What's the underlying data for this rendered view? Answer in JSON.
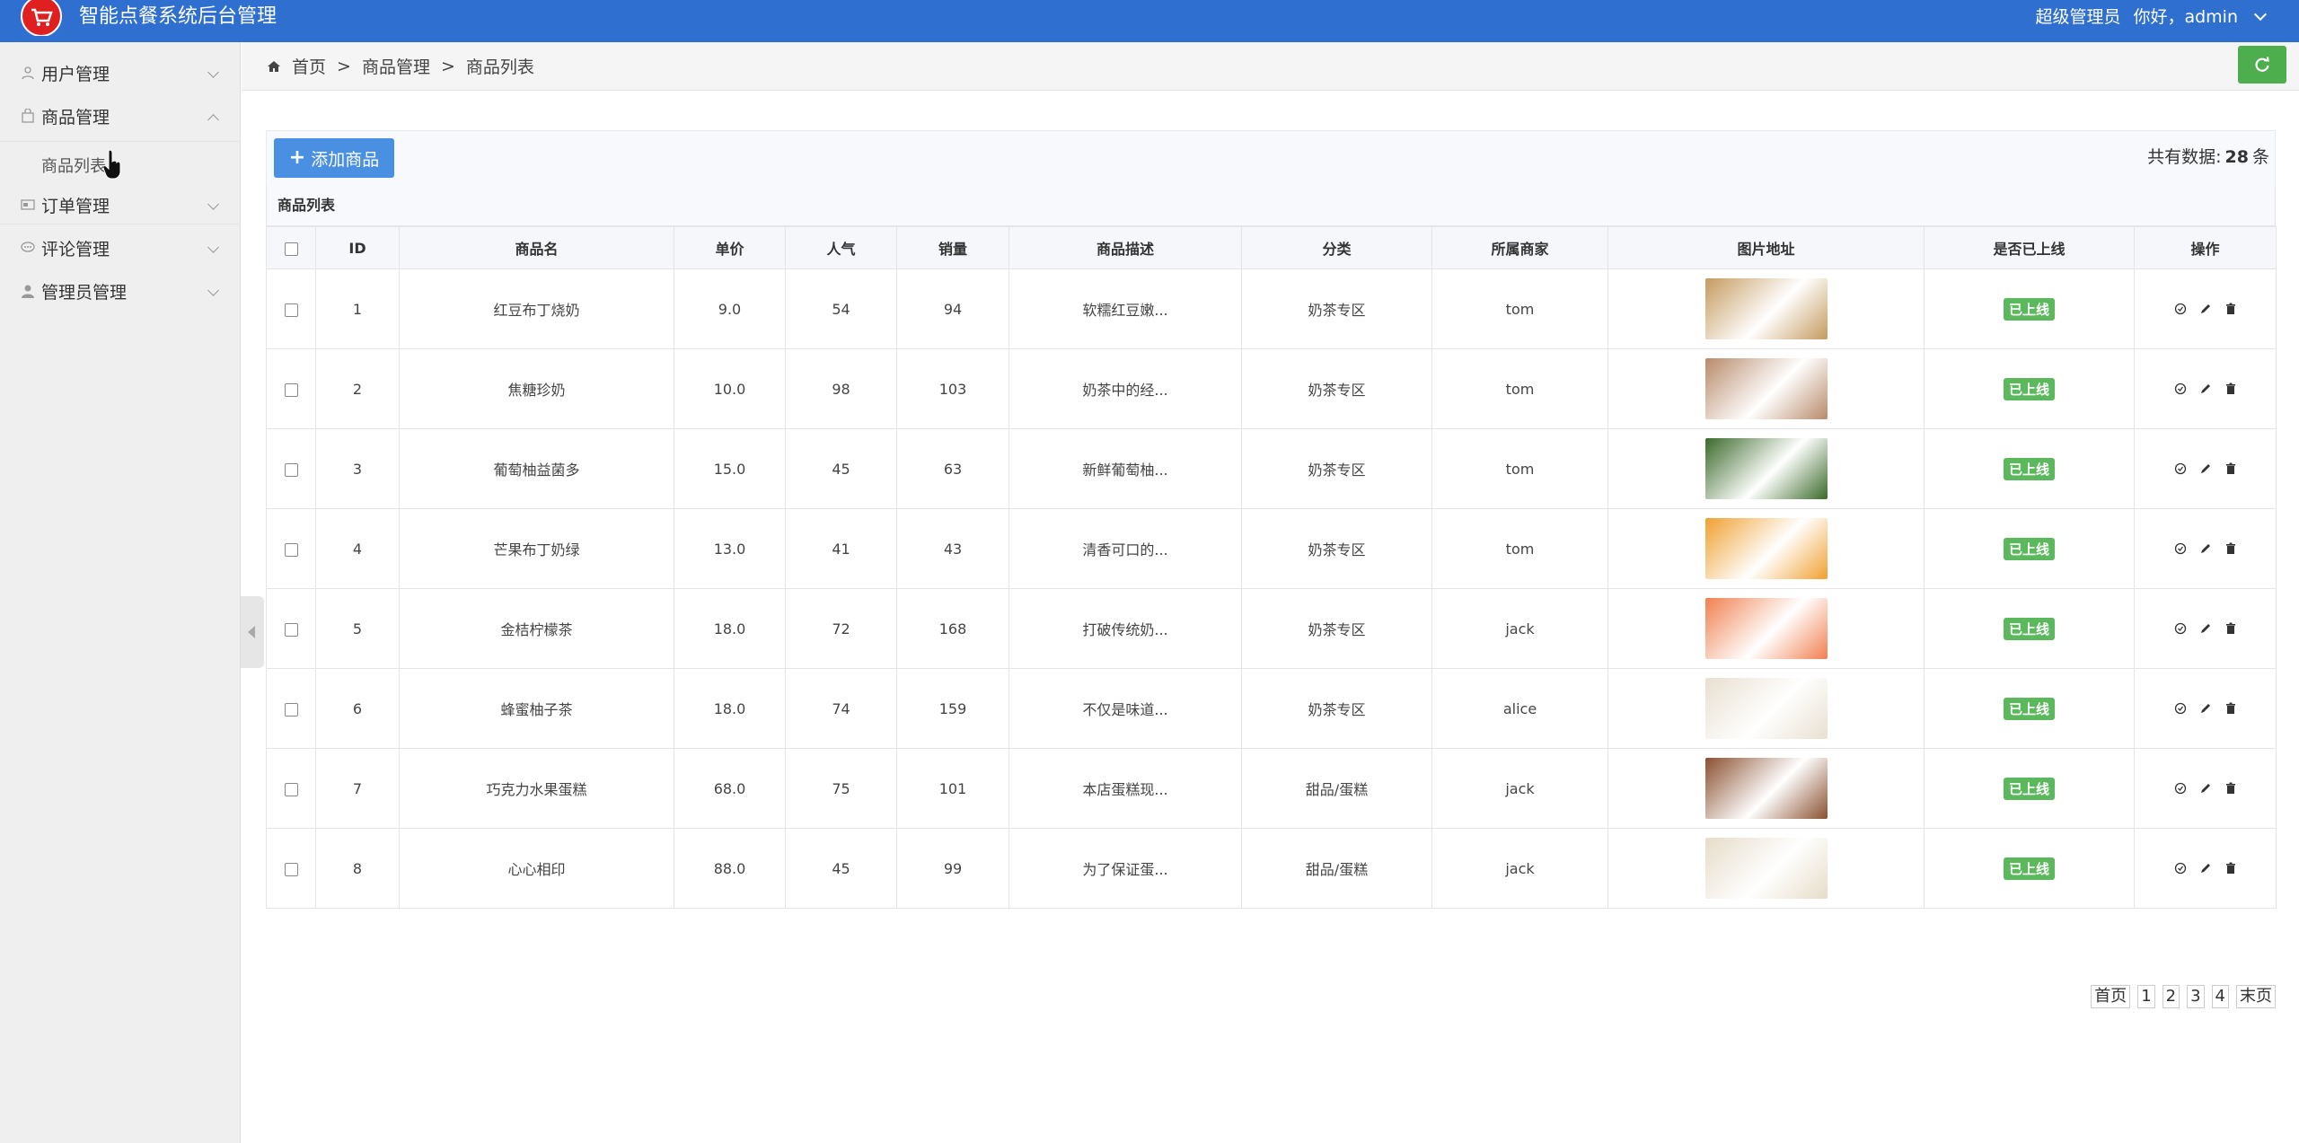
{
  "header": {
    "app_title": "智能点餐系统后台管理",
    "role": "超级管理员",
    "greeting": "你好，admin",
    "accent": "#2f6fd0"
  },
  "sidebar": {
    "items": [
      {
        "label": "用户管理",
        "icon": "user-icon"
      },
      {
        "label": "商品管理",
        "icon": "bag-icon"
      },
      {
        "label": "订单管理",
        "icon": "card-icon"
      },
      {
        "label": "评论管理",
        "icon": "chat-icon"
      },
      {
        "label": "管理员管理",
        "icon": "admin-icon"
      }
    ],
    "sub_item": "商品列表"
  },
  "breadcrumb": {
    "home": "首页",
    "sep": ">",
    "level1": "商品管理",
    "level2": "商品列表"
  },
  "toolbar": {
    "add_label": "添加商品",
    "total_prefix": "共有数据:",
    "total_count": "28",
    "total_suffix": "条"
  },
  "table": {
    "title": "商品列表",
    "headers": [
      "",
      "ID",
      "商品名",
      "单价",
      "人气",
      "销量",
      "商品描述",
      "分类",
      "所属商家",
      "图片地址",
      "是否已上线",
      "操作"
    ],
    "rows": [
      {
        "id": "1",
        "name": "红豆布丁烧奶",
        "price": "9.0",
        "popularity": "54",
        "sales": "94",
        "desc": "软糯红豆嫩...",
        "category": "奶茶专区",
        "merchant": "tom",
        "status": "已上线",
        "img_color": "#c59a5e"
      },
      {
        "id": "2",
        "name": "焦糖珍奶",
        "price": "10.0",
        "popularity": "98",
        "sales": "103",
        "desc": "奶茶中的经...",
        "category": "奶茶专区",
        "merchant": "tom",
        "status": "已上线",
        "img_color": "#b88a6a"
      },
      {
        "id": "3",
        "name": "葡萄柚益菌多",
        "price": "15.0",
        "popularity": "45",
        "sales": "63",
        "desc": "新鲜葡萄柚...",
        "category": "奶茶专区",
        "merchant": "tom",
        "status": "已上线",
        "img_color": "#3b6a2a"
      },
      {
        "id": "4",
        "name": "芒果布丁奶绿",
        "price": "13.0",
        "popularity": "41",
        "sales": "43",
        "desc": "清香可口的...",
        "category": "奶茶专区",
        "merchant": "tom",
        "status": "已上线",
        "img_color": "#f0a030"
      },
      {
        "id": "5",
        "name": "金桔柠檬茶",
        "price": "18.0",
        "popularity": "72",
        "sales": "168",
        "desc": "打破传统奶...",
        "category": "奶茶专区",
        "merchant": "jack",
        "status": "已上线",
        "img_color": "#f08050"
      },
      {
        "id": "6",
        "name": "蜂蜜柚子茶",
        "price": "18.0",
        "popularity": "74",
        "sales": "159",
        "desc": "不仅是味道...",
        "category": "奶茶专区",
        "merchant": "alice",
        "status": "已上线",
        "img_color": "#e8e0d0"
      },
      {
        "id": "7",
        "name": "巧克力水果蛋糕",
        "price": "68.0",
        "popularity": "75",
        "sales": "101",
        "desc": "本店蛋糕现...",
        "category": "甜品/蛋糕",
        "merchant": "jack",
        "status": "已上线",
        "img_color": "#8a5030"
      },
      {
        "id": "8",
        "name": "心心相印",
        "price": "88.0",
        "popularity": "45",
        "sales": "99",
        "desc": "为了保证蛋...",
        "category": "甜品/蛋糕",
        "merchant": "jack",
        "status": "已上线",
        "img_color": "#e6dcc8"
      }
    ]
  },
  "pager": {
    "first": "首页",
    "pages": [
      "1",
      "2",
      "3",
      "4"
    ],
    "last": "末页"
  },
  "colors": {
    "success": "#5cb85c",
    "primary": "#4a90e2",
    "refresh": "#4cae4c"
  }
}
